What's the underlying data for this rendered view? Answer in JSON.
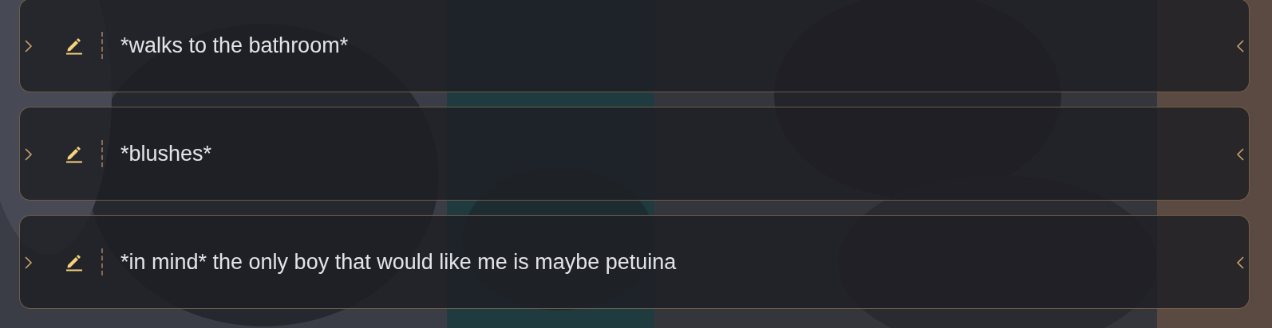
{
  "options": [
    {
      "text": "*walks to the bathroom*"
    },
    {
      "text": "*blushes*"
    },
    {
      "text": "*in mind* the only boy that would like me is maybe petuina"
    }
  ]
}
